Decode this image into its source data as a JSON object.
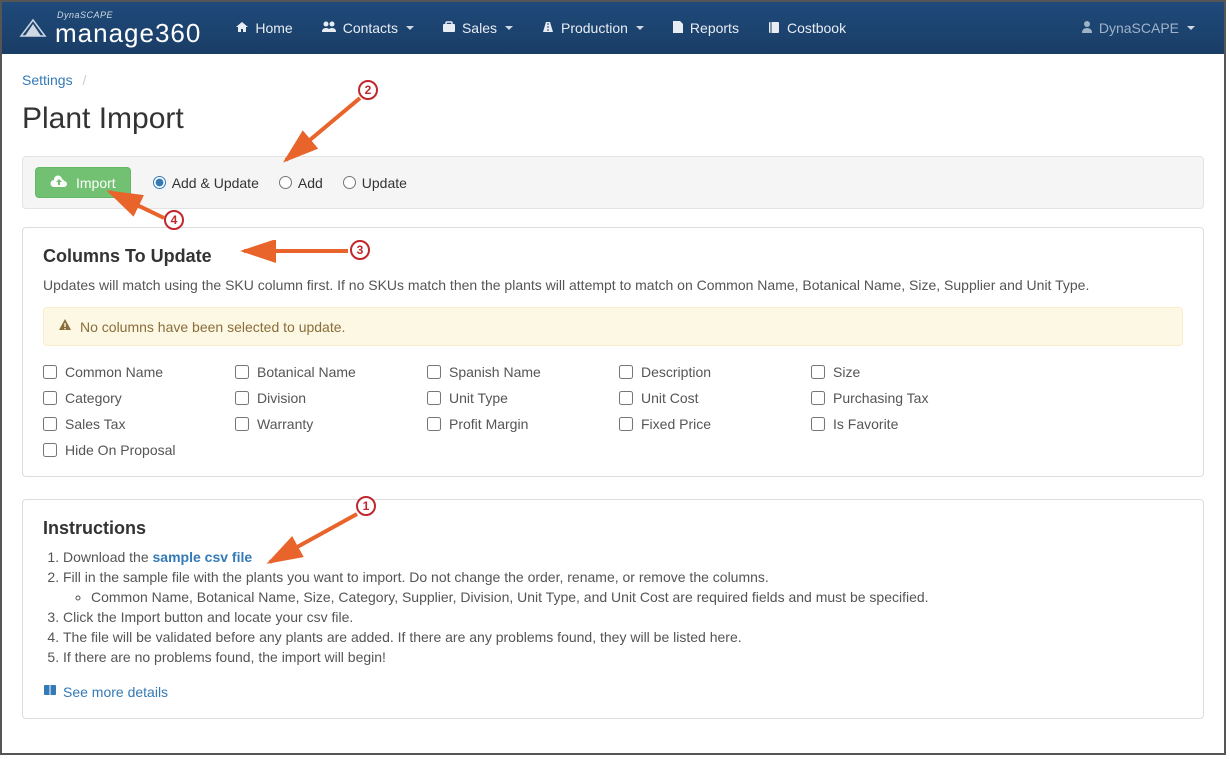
{
  "brand": {
    "super": "DynaSCAPE",
    "main": "manage360"
  },
  "nav": {
    "home": "Home",
    "contacts": "Contacts",
    "sales": "Sales",
    "production": "Production",
    "reports": "Reports",
    "costbook": "Costbook",
    "user": "DynaSCAPE"
  },
  "breadcrumb": {
    "settings": "Settings"
  },
  "page_title": "Plant Import",
  "toolbar": {
    "import": "Import",
    "radio_addupdate": "Add & Update",
    "radio_add": "Add",
    "radio_update": "Update"
  },
  "columns_panel": {
    "heading": "Columns To Update",
    "sub": "Updates will match using the SKU column first. If no SKUs match then the plants will attempt to match on Common Name, Botanical Name, Size, Supplier and Unit Type.",
    "alert": "No columns have been selected to update.",
    "cols": [
      "Common Name",
      "Botanical Name",
      "Spanish Name",
      "Description",
      "Size",
      "Category",
      "Division",
      "Unit Type",
      "Unit Cost",
      "Purchasing Tax",
      "Sales Tax",
      "Warranty",
      "Profit Margin",
      "Fixed Price",
      "Is Favorite",
      "Hide On Proposal"
    ]
  },
  "instructions": {
    "heading": "Instructions",
    "i1a": "Download the ",
    "i1link": "sample csv file",
    "i2": "Fill in the sample file with the plants you want to import. Do not change the order, rename, or remove the columns.",
    "i2a": "Common Name, Botanical Name, Size, Category, Supplier, Division, Unit Type, and Unit Cost are required fields and must be specified.",
    "i3": "Click the Import button and locate your csv file.",
    "i4": "The file will be validated before any plants are added. If there are any problems found, they will be listed here.",
    "i5": "If there are no problems found, the import will begin!",
    "more": "See more details"
  },
  "annotations": {
    "n1": "1",
    "n2": "2",
    "n3": "3",
    "n4": "4"
  }
}
